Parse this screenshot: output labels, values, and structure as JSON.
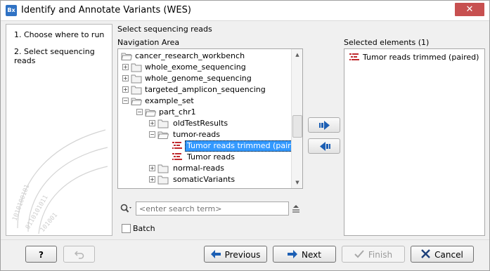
{
  "window": {
    "app_icon_text": "Bx",
    "title": "Identify and Annotate Variants (WES)"
  },
  "steps": [
    {
      "label": "1.  Choose where to run"
    },
    {
      "label": "2.  Select sequencing reads"
    }
  ],
  "main": {
    "section_title": "Select sequencing reads",
    "navigation_label": "Navigation Area",
    "selected_label": "Selected elements (1)"
  },
  "tree": {
    "items": [
      {
        "label": "cancer_research_workbench",
        "type": "folder-open"
      },
      {
        "label": "whole_exome_sequencing",
        "type": "folder"
      },
      {
        "label": "whole_genome_sequencing",
        "type": "folder"
      },
      {
        "label": "targeted_amplicon_sequencing",
        "type": "folder"
      },
      {
        "label": "example_set",
        "type": "folder-open"
      },
      {
        "label": "part_chr1",
        "type": "folder-open"
      },
      {
        "label": "oldTestResults",
        "type": "folder"
      },
      {
        "label": "tumor-reads",
        "type": "folder-open"
      },
      {
        "label": "Tumor reads trimmed (paired)",
        "type": "reads"
      },
      {
        "label": "Tumor reads",
        "type": "reads"
      },
      {
        "label": "normal-reads",
        "type": "folder"
      },
      {
        "label": "somaticVariants",
        "type": "folder"
      }
    ]
  },
  "search": {
    "placeholder": "<enter search term>"
  },
  "batch": {
    "label": "Batch",
    "checked": false
  },
  "selected": {
    "items": [
      {
        "label": "Tumor reads trimmed (paired)"
      }
    ]
  },
  "buttons": {
    "help": "?",
    "previous": "Previous",
    "next": "Next",
    "finish": "Finish",
    "cancel": "Cancel"
  },
  "colors": {
    "selection": "#3399ff",
    "arrow_blue": "#1c5fb4",
    "reads_red": "#c0282d",
    "close_red": "#c75050"
  }
}
